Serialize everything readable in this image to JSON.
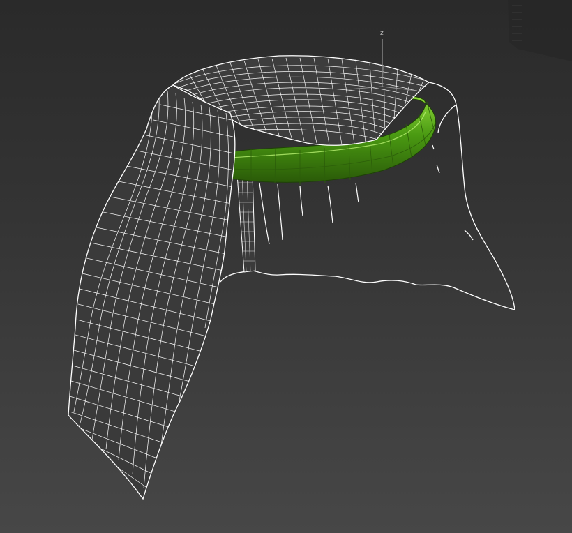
{
  "viewport": {
    "axis_label": "z",
    "background_color": "#333333",
    "wireframe_color": "#ffffff",
    "torus_color": "#4a9a12",
    "torus_highlight_color": "#8ed83a",
    "objects": [
      "cloth-mesh",
      "torus-ring"
    ]
  }
}
